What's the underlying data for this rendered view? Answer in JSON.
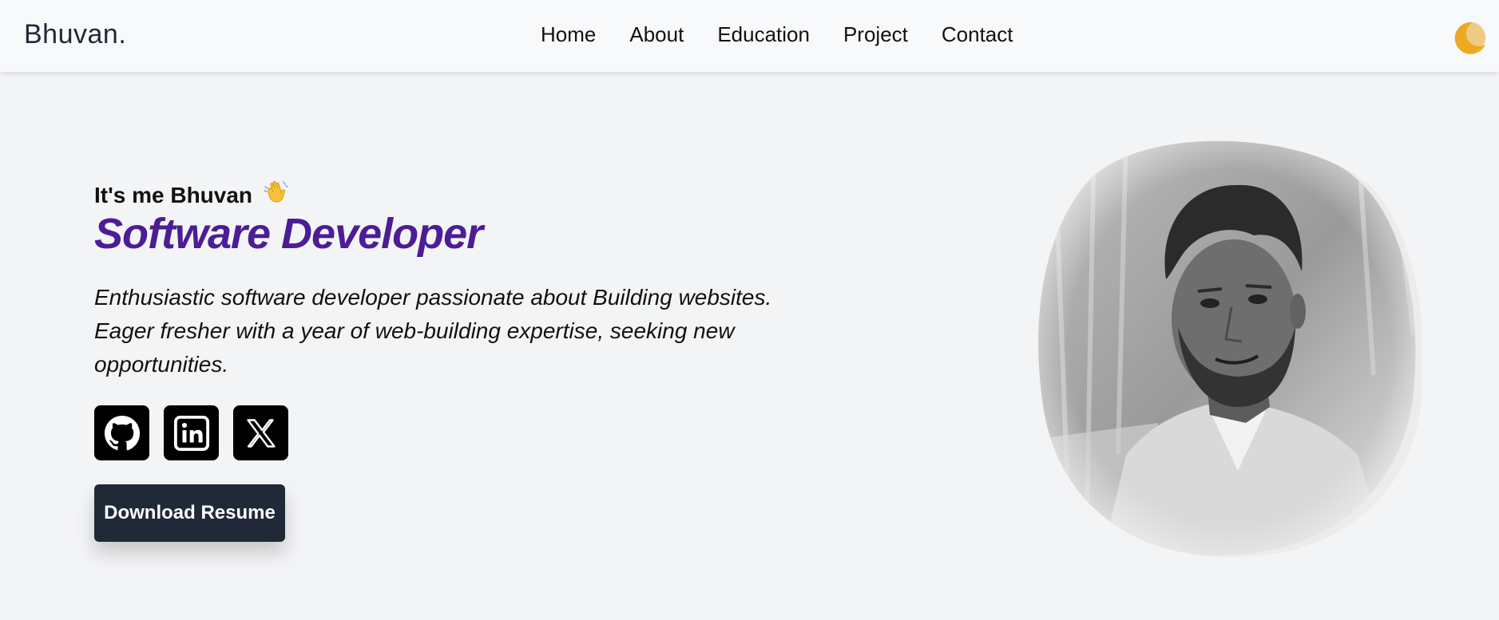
{
  "brand": "Bhuvan.",
  "nav": {
    "items": [
      {
        "label": "Home"
      },
      {
        "label": "About"
      },
      {
        "label": "Education"
      },
      {
        "label": "Project"
      },
      {
        "label": "Contact"
      }
    ]
  },
  "theme_toggle": {
    "icon": "moon-icon",
    "color": "#f5b731"
  },
  "hero": {
    "greeting": "It's me Bhuvan",
    "greeting_emoji": "👋",
    "title": "Software Developer",
    "description": "Enthusiastic software developer passionate about Building websites. Eager fresher with a year of web-building expertise, seeking new opportunities.",
    "socials": [
      {
        "icon": "github-icon"
      },
      {
        "icon": "linkedin-icon"
      },
      {
        "icon": "x-twitter-icon"
      }
    ],
    "resume_label": "Download Resume"
  },
  "colors": {
    "accent": "#4c1d95",
    "button": "#1f2937",
    "background": "#f3f4f6",
    "navbar": "#f8f9fb"
  }
}
